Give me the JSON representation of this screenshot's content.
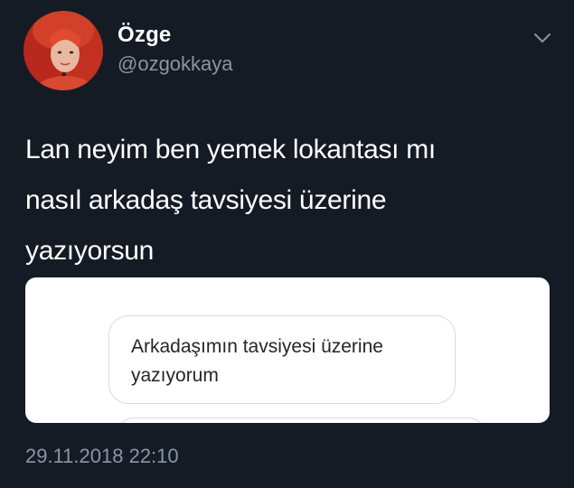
{
  "user": {
    "display_name": "Özge",
    "handle": "@ozgokkaya",
    "avatar_icon": "profile-photo-red-hair"
  },
  "tweet": {
    "text_lines": [
      "Lan neyim ben yemek lokantası mı",
      "nasıl arkadaş tavsiyesi üzerine",
      "yazıyorsun"
    ],
    "timestamp": "29.11.2018 22:10"
  },
  "media": {
    "message_lines": [
      "Arkadaşımın tavsiyesi üzerine",
      "yazıyorum"
    ]
  },
  "icons": {
    "menu": "chevron-down-icon"
  },
  "colors": {
    "background": "#151b25",
    "text_primary": "#ffffff",
    "text_secondary": "#8a96a3",
    "card_background": "#ffffff",
    "bubble_border": "#dadada"
  }
}
